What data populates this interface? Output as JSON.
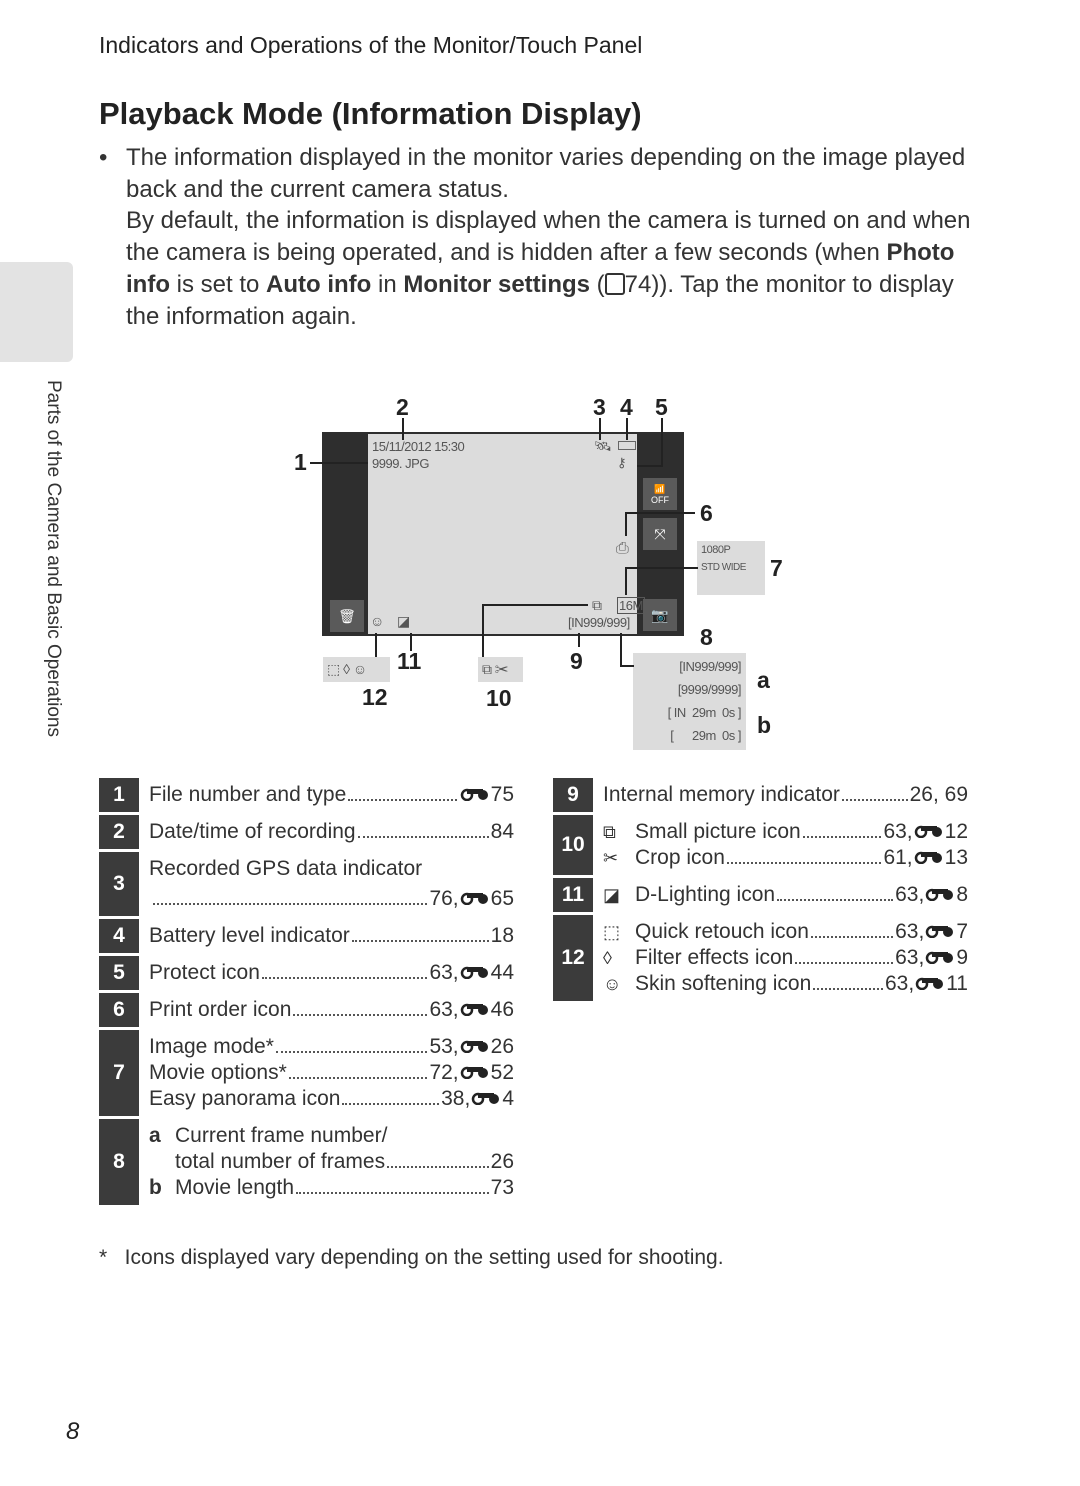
{
  "header": "Indicators and Operations of the Monitor/Touch Panel",
  "title": "Playback Mode (Information Display)",
  "body": {
    "p1": "The information displayed in the monitor varies depending on the image played back and the current camera status.",
    "p2a": "By default, the information is displayed when the camera is turned on and when the camera is being operated, and is hidden after a few seconds (when ",
    "b1": "Photo info",
    "p2b": " is set to ",
    "b2": "Auto info",
    "p2c": " in ",
    "b3": "Monitor settings",
    "p2d": " (",
    "ref": "74",
    "p2e": ")). Tap the monitor to display the information again."
  },
  "side_label": "Parts of the Camera and Basic Operations",
  "diagram": {
    "datetime": "15/11/2012 15:30",
    "file": "9999. JPG",
    "frame": "[IN999/999]",
    "size": "16M",
    "wifi": "OFF",
    "movie_mode": "1080P",
    "std": "STD",
    "wide": "WIDE",
    "b8": [
      "[IN999/999]",
      "[9999/9999]",
      "[ IN  29m  0s ]",
      "[      29m  0s ]"
    ],
    "callouts": [
      "1",
      "2",
      "3",
      "4",
      "5",
      "6",
      "7",
      "8",
      "9",
      "10",
      "11",
      "12",
      "a",
      "b"
    ]
  },
  "left_table": [
    {
      "num": "1",
      "items": [
        {
          "label": "File number and type",
          "pages": "",
          "ref": "75"
        }
      ]
    },
    {
      "num": "2",
      "items": [
        {
          "label": "Date/time of recording",
          "pages": "84",
          "ref": ""
        }
      ]
    },
    {
      "num": "3",
      "items": [
        {
          "label": "Recorded GPS data indicator",
          "pages": "76, ",
          "ref": "65",
          "wrap": true
        }
      ]
    },
    {
      "num": "4",
      "items": [
        {
          "label": "Battery level indicator",
          "pages": "18",
          "ref": ""
        }
      ]
    },
    {
      "num": "5",
      "items": [
        {
          "label": "Protect icon",
          "pages": "63, ",
          "ref": "44"
        }
      ]
    },
    {
      "num": "6",
      "items": [
        {
          "label": "Print order icon",
          "pages": "63, ",
          "ref": "46"
        }
      ]
    },
    {
      "num": "7",
      "items": [
        {
          "label": "Image mode*",
          "pages": "53, ",
          "ref": "26"
        },
        {
          "label": "Movie options*",
          "pages": "72, ",
          "ref": "52"
        },
        {
          "label": "Easy panorama icon",
          "pages": "38, ",
          "ref": "4"
        }
      ]
    },
    {
      "num": "8",
      "items": [
        {
          "letter": "a",
          "label": "Current frame number/",
          "pages": "",
          "ref": "",
          "nodots": true
        },
        {
          "letter": "",
          "label": "total number of frames",
          "pages": "26",
          "ref": ""
        },
        {
          "letter": "b",
          "label": "Movie length",
          "pages": "73",
          "ref": ""
        }
      ]
    }
  ],
  "right_table": [
    {
      "num": "9",
      "items": [
        {
          "label": "Internal memory indicator",
          "pages": "26, 69",
          "ref": ""
        }
      ]
    },
    {
      "num": "10",
      "items": [
        {
          "icon": "small-picture-icon",
          "glyph": "⧉",
          "label": "Small picture icon",
          "pages": "63, ",
          "ref": "12"
        },
        {
          "icon": "crop-icon",
          "glyph": "✂",
          "label": "Crop icon",
          "pages": "61, ",
          "ref": "13"
        }
      ]
    },
    {
      "num": "11",
      "items": [
        {
          "icon": "d-lighting-icon",
          "glyph": "◪",
          "label": "D-Lighting icon",
          "pages": "63, ",
          "ref": "8"
        }
      ]
    },
    {
      "num": "12",
      "items": [
        {
          "icon": "quick-retouch-icon",
          "glyph": "⬚",
          "label": "Quick retouch icon",
          "pages": "63, ",
          "ref": "7"
        },
        {
          "icon": "filter-effects-icon",
          "glyph": "◊",
          "label": "Filter effects icon",
          "pages": "63, ",
          "ref": "9"
        },
        {
          "icon": "skin-softening-icon",
          "glyph": "☺",
          "label": "Skin softening icon",
          "pages": "63, ",
          "ref": "11"
        }
      ]
    }
  ],
  "footnote": "*   Icons displayed vary depending on the setting used for shooting.",
  "page_number": "8"
}
